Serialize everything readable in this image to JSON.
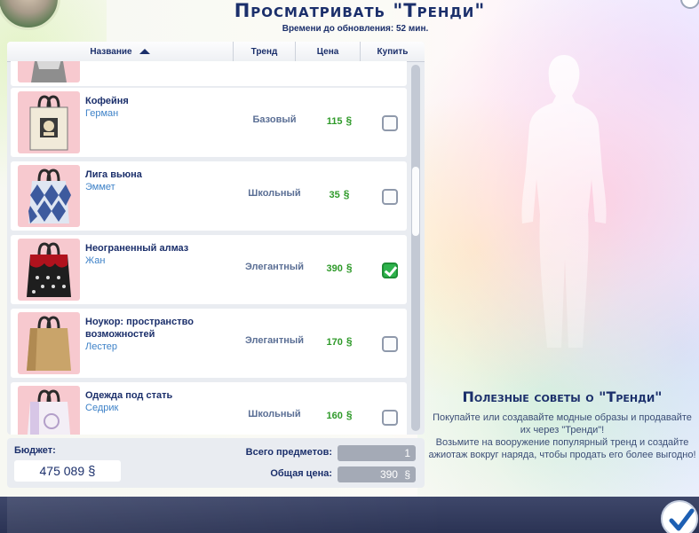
{
  "header": {
    "title": "Просматривать \"Тренди\"",
    "subtitle": "Времени до обновления: 52 мин."
  },
  "table": {
    "columns": {
      "name": "Название",
      "trend": "Тренд",
      "price": "Цена",
      "buy": "Купить"
    },
    "sort": "name-ascending",
    "items": [
      {
        "name": "Кофейня",
        "author": "Герман",
        "trend": "Базовый",
        "price": "115",
        "checked": false,
        "icon": "coffee-shop-bag-icon"
      },
      {
        "name": "Лига вьюна",
        "author": "Эммет",
        "trend": "Школьный",
        "price": "35",
        "checked": false,
        "icon": "argyle-bag-icon"
      },
      {
        "name": "Неограненный алмаз",
        "author": "Жан",
        "trend": "Элегантный",
        "price": "390",
        "checked": true,
        "icon": "diamond-bag-icon"
      },
      {
        "name": "Ноукор: пространство возможностей",
        "author": "Лестер",
        "trend": "Элегантный",
        "price": "170",
        "checked": false,
        "icon": "kraft-paper-bag-icon"
      },
      {
        "name": "Одежда под стать",
        "author": "Седрик",
        "trend": "Школьный",
        "price": "160",
        "checked": false,
        "icon": "white-logo-bag-icon"
      }
    ]
  },
  "currency_symbol": "§",
  "summary": {
    "budget_label": "Бюджет:",
    "budget_value": "475 089",
    "total_items_label": "Всего предметов:",
    "total_items_value": "1",
    "total_price_label": "Общая цена:",
    "total_price_value": "390"
  },
  "tips": {
    "title": "Полезные советы о \"Тренди\"",
    "line1": "Покупайте или создавайте модные образы и продавайте их через \"Тренди\"!",
    "line2": "Возьмите на вооружение популярный тренд и создайте ажиотаж вокруг наряда, чтобы продать его более выгодно!"
  },
  "colors": {
    "title_navy": "#1b2f6b",
    "price_green": "#2f9a2a",
    "author_blue": "#3e82c8",
    "check_green": "#2eb34c"
  }
}
